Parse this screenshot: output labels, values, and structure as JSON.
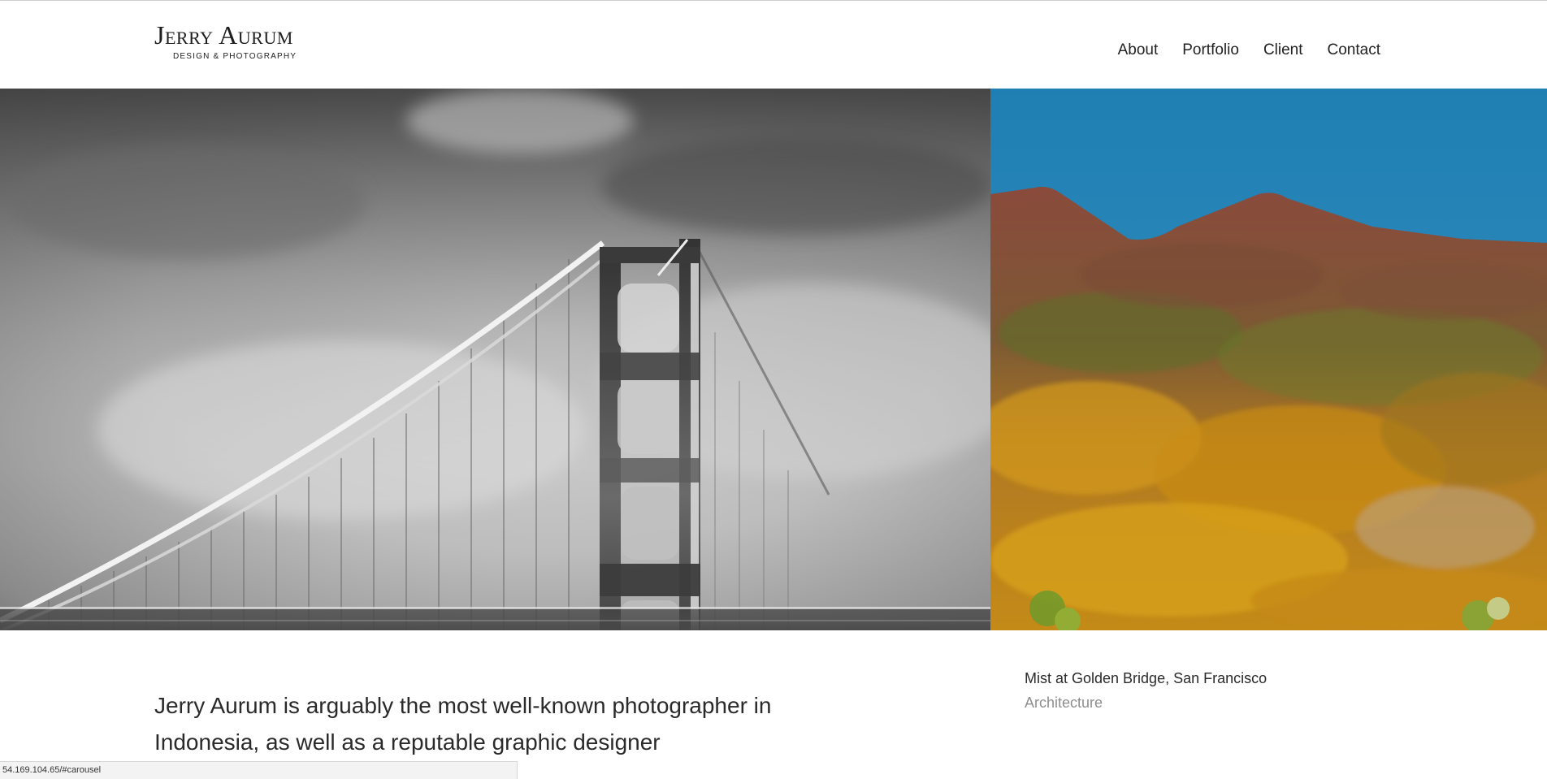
{
  "header": {
    "logo_name": "Jerry Aurum",
    "logo_tagline": "DESIGN & PHOTOGRAPHY",
    "nav": [
      {
        "label": "About"
      },
      {
        "label": "Portfolio"
      },
      {
        "label": "Client"
      },
      {
        "label": "Contact"
      }
    ]
  },
  "carousel": {
    "slides": [
      {
        "image": "golden-bridge-in-fog-photo"
      },
      {
        "image": "autumn-mountain-photo"
      }
    ]
  },
  "intro": {
    "tagline": "Jerry Aurum is arguably the most well-known photographer in Indonesia, as well as a reputable graphic designer"
  },
  "caption": {
    "title": "Mist at Golden Bridge, San Francisco",
    "category": "Architecture"
  },
  "status_bar": {
    "url": "54.169.104.65/#carousel"
  },
  "colors": {
    "text": "#2a2a2a",
    "muted": "#8e8e8e",
    "sky": "#2a86b8"
  }
}
